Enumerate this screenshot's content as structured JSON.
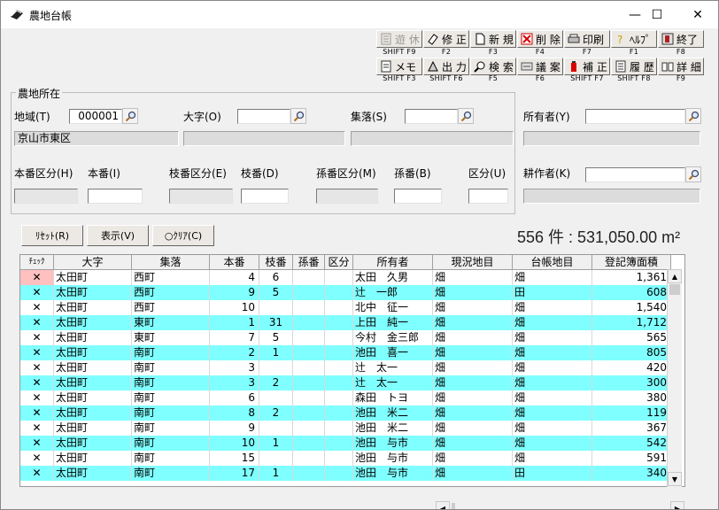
{
  "window": {
    "title": "農地台帳",
    "minimize": "—",
    "maximize": "☐",
    "close": "✕"
  },
  "toolbar": {
    "row1": [
      {
        "label": "遊 休",
        "fkey": "SHIFT F9",
        "icon": "list-icon",
        "disabled": true
      },
      {
        "label": "修 正",
        "fkey": "F2",
        "icon": "eraser-icon"
      },
      {
        "label": "新 規",
        "fkey": "F3",
        "icon": "new-doc-icon"
      },
      {
        "label": "削 除",
        "fkey": "F4",
        "icon": "delete-icon"
      },
      {
        "label": "印刷",
        "fkey": "F7",
        "icon": "printer-icon"
      },
      {
        "label": "ﾍﾙﾌﾟ",
        "fkey": "F1",
        "icon": "help-icon"
      },
      {
        "label": "終了",
        "fkey": "F8",
        "icon": "exit-icon"
      }
    ],
    "row2": [
      {
        "label": "メモ",
        "fkey": "SHIFT F3",
        "icon": "memo-icon"
      },
      {
        "label": "出 力",
        "fkey": "SHIFT F6",
        "icon": "output-icon"
      },
      {
        "label": "検 索",
        "fkey": "F5",
        "icon": "search-icon"
      },
      {
        "label": "議 案",
        "fkey": "F6",
        "icon": "agenda-icon"
      },
      {
        "label": "補 正",
        "fkey": "SHIFT F7",
        "icon": "correction-icon"
      },
      {
        "label": "履 歴",
        "fkey": "SHIFT F8",
        "icon": "history-icon"
      },
      {
        "label": "詳 細",
        "fkey": "F9",
        "icon": "detail-icon"
      }
    ]
  },
  "location_group": {
    "title": "農地所在",
    "region_label": "地域(T)",
    "region_value": "000001",
    "oaza_label": "大字(O)",
    "oaza_value": "",
    "shuraku_label": "集落(S)",
    "shuraku_value": "",
    "region_name": "京山市東区",
    "honban_kubun_label": "本番区分(H)",
    "honban_label": "本番(I)",
    "edaban_kubun_label": "枝番区分(E)",
    "edaban_label": "枝番(D)",
    "magoban_kubun_label": "孫番区分(M)",
    "magoban_label": "孫番(B)",
    "kubun_label": "区分(U)"
  },
  "owner": {
    "owner_label": "所有者(Y)",
    "owner_value": "",
    "cultivator_label": "耕作者(K)",
    "cultivator_value": ""
  },
  "buttons": {
    "reset": "ﾘｾｯﾄ(R)",
    "display": "表示(V)",
    "clear": "○ｸﾘｱ(C)"
  },
  "summary": {
    "count_text": "556 件 : 531,050.00 m²"
  },
  "grid": {
    "columns": [
      "ﾁｪｯｸ",
      "大字",
      "集落",
      "本番",
      "枝番",
      "孫番",
      "区分",
      "所有者",
      "現況地目",
      "台帳地目",
      "登記簿面積"
    ],
    "rows": [
      [
        "✕",
        "太田町",
        "西町",
        "4",
        "6",
        "",
        "",
        "太田　久男",
        "畑",
        "畑",
        "1,361"
      ],
      [
        "✕",
        "太田町",
        "西町",
        "9",
        "5",
        "",
        "",
        "辻　一郎",
        "畑",
        "田",
        "608"
      ],
      [
        "✕",
        "太田町",
        "西町",
        "10",
        "",
        "",
        "",
        "北中　征一",
        "畑",
        "畑",
        "1,540"
      ],
      [
        "✕",
        "太田町",
        "東町",
        "1",
        "31",
        "",
        "",
        "上田　純一",
        "畑",
        "畑",
        "1,712"
      ],
      [
        "✕",
        "太田町",
        "東町",
        "7",
        "5",
        "",
        "",
        "今村　金三郎",
        "畑",
        "畑",
        "565"
      ],
      [
        "✕",
        "太田町",
        "南町",
        "2",
        "1",
        "",
        "",
        "池田　喜一",
        "畑",
        "畑",
        "805"
      ],
      [
        "✕",
        "太田町",
        "南町",
        "3",
        "",
        "",
        "",
        "辻　太一",
        "畑",
        "畑",
        "420"
      ],
      [
        "✕",
        "太田町",
        "南町",
        "3",
        "2",
        "",
        "",
        "辻　太一",
        "畑",
        "畑",
        "300"
      ],
      [
        "✕",
        "太田町",
        "南町",
        "6",
        "",
        "",
        "",
        "森田　トヨ",
        "畑",
        "畑",
        "380"
      ],
      [
        "✕",
        "太田町",
        "南町",
        "8",
        "2",
        "",
        "",
        "池田　米二",
        "畑",
        "畑",
        "119"
      ],
      [
        "✕",
        "太田町",
        "南町",
        "9",
        "",
        "",
        "",
        "池田　米二",
        "畑",
        "畑",
        "367"
      ],
      [
        "✕",
        "太田町",
        "南町",
        "10",
        "1",
        "",
        "",
        "池田　与市",
        "畑",
        "畑",
        "542"
      ],
      [
        "✕",
        "太田町",
        "南町",
        "15",
        "",
        "",
        "",
        "池田　与市",
        "畑",
        "畑",
        "591"
      ],
      [
        "✕",
        "太田町",
        "南町",
        "17",
        "1",
        "",
        "",
        "池田　与市",
        "畑",
        "田",
        "340"
      ]
    ]
  },
  "colors": {
    "row_alt": "#7fffff",
    "row_normal": "#ffffff",
    "selected_check": "#ffc0c0"
  }
}
